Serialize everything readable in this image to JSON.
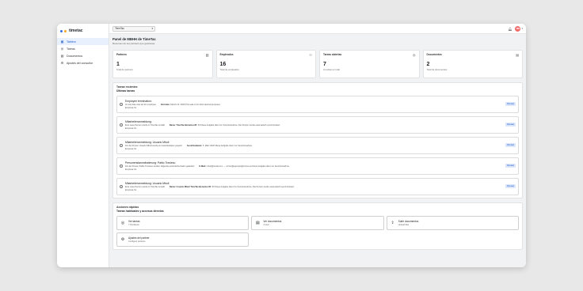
{
  "app": {
    "logo_text": "timetac",
    "logo_colors": [
      "#2f6fe4",
      "#f5a623"
    ]
  },
  "sidebar": {
    "items": [
      {
        "label": "Tablero",
        "icon": "grid-icon",
        "active": true
      },
      {
        "label": "Tareas",
        "icon": "check-circle-icon",
        "active": false
      },
      {
        "label": "Documentos",
        "icon": "document-icon",
        "active": false
      },
      {
        "label": "Ajustes del consultor",
        "icon": "gear-icon",
        "active": false
      }
    ]
  },
  "topbar": {
    "tenant_value": "TimeTac",
    "avatar_initials": "MB"
  },
  "main": {
    "title": "Panel de MBHH de TimeTac",
    "subtitle": "Resumen de tus partners que gestionas"
  },
  "stats": [
    {
      "label": "Partners",
      "value": "1",
      "note": "Total de partners",
      "icon": "building-icon"
    },
    {
      "label": "Empleados",
      "value": "16",
      "note": "Total de empleados",
      "icon": "users-icon"
    },
    {
      "label": "Tareas abiertas",
      "value": "7",
      "note": "A revisar en total",
      "icon": "check-circle-icon"
    },
    {
      "label": "Documentos",
      "value": "2",
      "note": "Total de documentos",
      "icon": "document-icon"
    }
  ],
  "tasks_panel": {
    "title": "Tareas recientes",
    "subtitle": "Últimas tareas",
    "button_label": "Revisar",
    "tasks": [
      {
        "title": "Employee termination:",
        "desc": "An exit date was set for employee",
        "key": "Exit date:",
        "detail": "March 15, 2026 This task is for informational purposes.",
        "company": "Empresa SL"
      },
      {
        "title": "Mitarbeiteranmeldung:",
        "desc": "Eine neue Person wurde in TimeTac erstellt",
        "key": "Name: TimeTac-Benutzer-ID:",
        "detail": "54 Diese Aufgabe dient zur Kenntnisnahme. Die Person wurde automatisch synchronisiert.",
        "company": "Empresa SL"
      },
      {
        "title": "Mitarbeiteranmeldung: Usuario Mbuil",
        "desc": "Für die Person Usuario Mbuil wurde ein Austrittsdatum gesetzt",
        "key": "Austrittsdatum:",
        "detail": "5. März 2026 Diese Aufgabe dient zur Kenntnisnahme.",
        "company": "Empresa SL"
      },
      {
        "title": "Personenstammänderung: Pablo Travieso",
        "desc": "Für die Person Pablo Travieso wurden folgende persönliche Daten geändert",
        "key": "E-Mail:",
        "detail": "mbuil@email.com → correo@ejemplo@correo.es Diese Aufgabe dient zur Kenntnisnahme.",
        "company": "Empresa SL"
      },
      {
        "title": "Mitarbeiteranmeldung: Usuario Mbuil",
        "desc": "Eine neue Person wurde in TimeTac erstellt",
        "key": "Name: Usuario Mbuil TimeTac-Benutzer-ID:",
        "detail": "53 Diese Aufgabe dient zur Kenntnisnahme. Die Person wurde automatisch synchronisiert.",
        "company": "Empresa SL"
      }
    ]
  },
  "quick_actions": {
    "title": "Acciones rápidas",
    "subtitle": "Tareas habituales y accesos directos",
    "items": [
      {
        "title": "Ver tareas",
        "sub": "7 Pendiente",
        "icon": "check-circle-icon"
      },
      {
        "title": "Ver documentos",
        "sub": "2 total",
        "icon": "document-icon"
      },
      {
        "title": "Subir documentos",
        "sub": "Upload files",
        "icon": "upload-icon"
      },
      {
        "title": "Ajustes del partner",
        "sub": "Configure partners",
        "icon": "gear-icon"
      }
    ]
  }
}
